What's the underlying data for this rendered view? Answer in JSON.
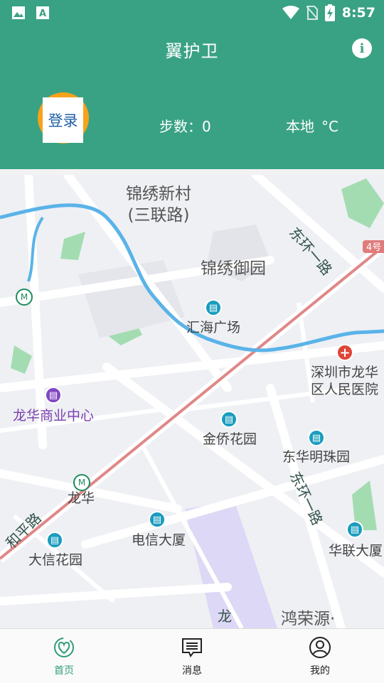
{
  "status_bar": {
    "time": "8:57",
    "icons": [
      "image-icon",
      "text-icon",
      "wifi-icon",
      "no-sim-icon",
      "battery-charging-icon"
    ]
  },
  "header": {
    "title": "翼护卫",
    "info_icon": "info-icon",
    "login_label": "登录",
    "steps_label": "步数：0",
    "location_label": "本地",
    "temperature_unit": "°C",
    "color": "#3aa284"
  },
  "map": {
    "labels": {
      "jinxiu_xincun": "锦绣新村(三联路)",
      "jinxiu_yuyuan": "锦绣御园",
      "huihai": "汇海广场",
      "hospital": "深圳市龙华区人民医院",
      "commerce": "龙华商业中心",
      "jinqiao": "金侨花园",
      "donghua": "东华明珠园",
      "longhua": "龙华",
      "dianxin": "电信大厦",
      "daxin": "大信花园",
      "hualian": "华联大厦",
      "hongrong": "鸿荣源·",
      "road_donghuan_1": "东环一路",
      "road_donghuan_2": "东环一路",
      "road_heping": "和平路",
      "road_long": "龙"
    },
    "metro_badge": "4号"
  },
  "tabbar": {
    "items": [
      {
        "label": "首页",
        "icon": "heart-home-icon",
        "active": true
      },
      {
        "label": "消息",
        "icon": "message-icon",
        "active": false
      },
      {
        "label": "我的",
        "icon": "profile-icon",
        "active": false
      }
    ]
  }
}
